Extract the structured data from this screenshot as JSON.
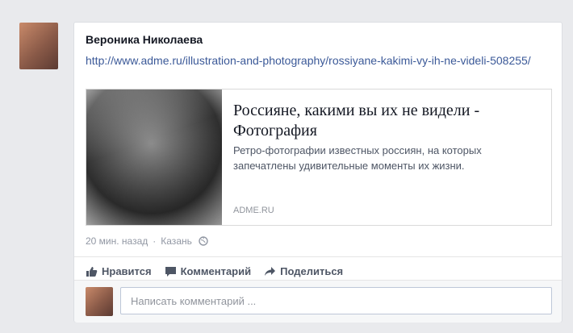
{
  "post": {
    "author_name": "Вероника Николаева",
    "link_text": "http://www.adme.ru/illustration-and-photography/rossiyane-kakimi-vy-ih-ne-videli-508255/"
  },
  "link_preview": {
    "title": "Россияне, какими вы их не видели - Фотография",
    "description": "Ретро-фотографии известных россиян, на которых запечатлены удивительные моменты их жизни.",
    "domain": "ADME.RU"
  },
  "meta": {
    "time": "20 мин. назад",
    "separator": "·",
    "location": "Казань",
    "privacy_icon": "globe-icon"
  },
  "actions": {
    "like_label": "Нравится",
    "comment_label": "Комментарий",
    "share_label": "Поделиться"
  },
  "comment": {
    "placeholder": "Написать комментарий ...",
    "value": ""
  },
  "colors": {
    "page_bg": "#e9eaed",
    "link": "#3b5998",
    "text": "#141823",
    "muted": "#9197a3"
  }
}
